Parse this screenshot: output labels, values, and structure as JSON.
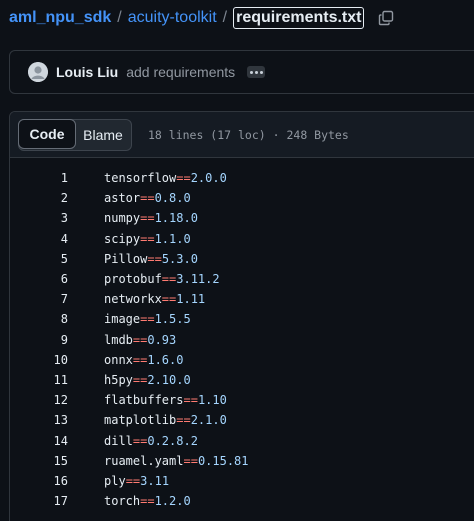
{
  "breadcrumb": {
    "repo": "aml_npu_sdk",
    "sep": "/",
    "folder": "acuity-toolkit",
    "file": "requirements.txt",
    "copy_icon": "copy-icon"
  },
  "commit": {
    "avatar_icon": "user-avatar",
    "author": "Louis Liu",
    "message": "add requirements",
    "more_icon": "ellipsis-icon"
  },
  "file": {
    "tabs": {
      "code": "Code",
      "blame": "Blame"
    },
    "meta": "18 lines (17 loc) · 248 Bytes",
    "lines": [
      {
        "num": "1",
        "pkg": "tensorflow",
        "op": "==",
        "ver": "2.0.0"
      },
      {
        "num": "2",
        "pkg": "astor",
        "op": "==",
        "ver": "0.8.0"
      },
      {
        "num": "3",
        "pkg": "numpy",
        "op": "==",
        "ver": "1.18.0"
      },
      {
        "num": "4",
        "pkg": "scipy",
        "op": "==",
        "ver": "1.1.0"
      },
      {
        "num": "5",
        "pkg": "Pillow",
        "op": "==",
        "ver": "5.3.0"
      },
      {
        "num": "6",
        "pkg": "protobuf",
        "op": "==",
        "ver": "3.11.2"
      },
      {
        "num": "7",
        "pkg": "networkx",
        "op": "==",
        "ver": "1.11"
      },
      {
        "num": "8",
        "pkg": "image",
        "op": "==",
        "ver": "1.5.5"
      },
      {
        "num": "9",
        "pkg": "lmdb",
        "op": "==",
        "ver": "0.93"
      },
      {
        "num": "10",
        "pkg": "onnx",
        "op": "==",
        "ver": "1.6.0"
      },
      {
        "num": "11",
        "pkg": "h5py",
        "op": "==",
        "ver": "2.10.0"
      },
      {
        "num": "12",
        "pkg": "flatbuffers",
        "op": "==",
        "ver": "1.10"
      },
      {
        "num": "13",
        "pkg": "matplotlib",
        "op": "==",
        "ver": "2.1.0"
      },
      {
        "num": "14",
        "pkg": "dill",
        "op": "==",
        "ver": "0.2.8.2"
      },
      {
        "num": "15",
        "pkg": "ruamel.yaml",
        "op": "==",
        "ver": "0.15.81"
      },
      {
        "num": "16",
        "pkg": "ply",
        "op": "==",
        "ver": "3.11"
      },
      {
        "num": "17",
        "pkg": "torch",
        "op": "==",
        "ver": "1.2.0"
      }
    ]
  },
  "colors": {
    "background": "#0d1117",
    "link": "#4493f8",
    "operator": "#ff7b72",
    "version": "#a5d6ff",
    "border": "#30363d"
  }
}
